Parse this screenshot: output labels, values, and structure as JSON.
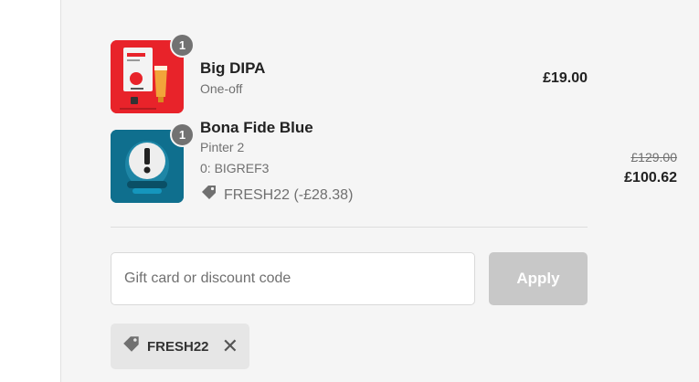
{
  "cart": {
    "items": [
      {
        "quantity": "1",
        "name": "Big DIPA",
        "variant": "One-off",
        "price": "£19.00"
      },
      {
        "quantity": "1",
        "name": "Bona Fide Blue",
        "variant": "Pinter 2",
        "code_line": "0: BIGREF3",
        "discount_line": "FRESH22 (-£28.38)",
        "original_price": "£129.00",
        "price": "£100.62"
      }
    ]
  },
  "discount": {
    "placeholder": "Gift card or discount code",
    "apply_label": "Apply",
    "applied_code": "FRESH22"
  },
  "icons": {
    "tag": "tag-icon",
    "close": "close-icon"
  },
  "colors": {
    "apply_disabled": "#c8c8c8",
    "badge": "#727272",
    "product_red": "#e8232a",
    "product_teal": "#0f6f8e"
  }
}
